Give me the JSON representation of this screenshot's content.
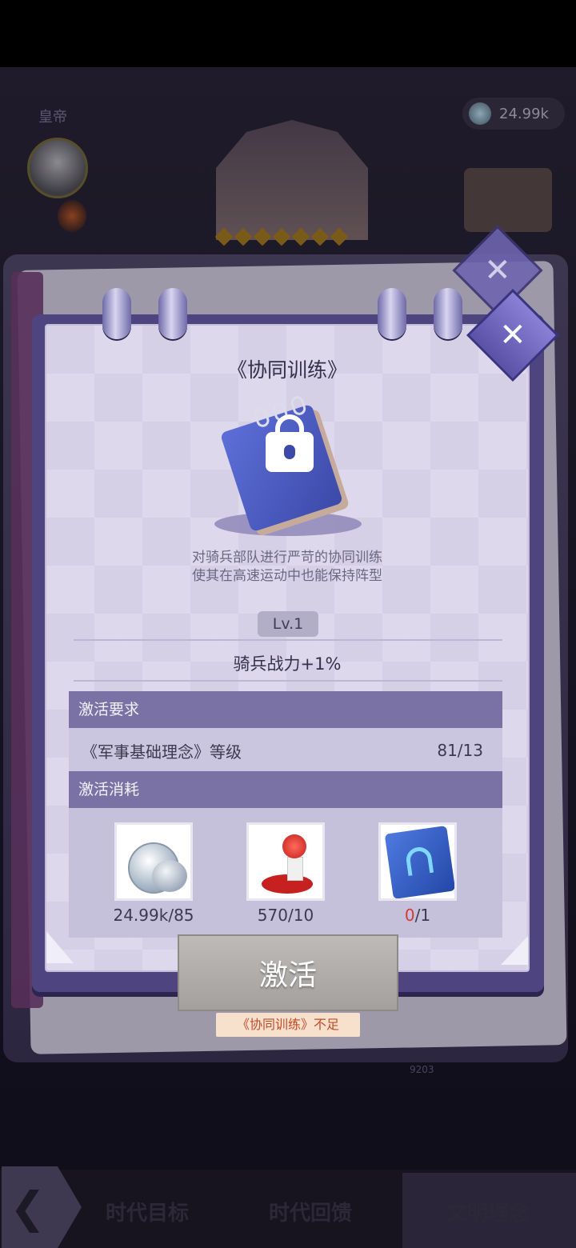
{
  "background": {
    "label_top_left": "皇帝",
    "currency_value": "24.99k",
    "small_number": "9203"
  },
  "dialog": {
    "title": "《协同训练》",
    "description_line1": "对骑兵部队进行严苛的协同训练",
    "description_line2": "使其在高速运动中也能保持阵型",
    "level": "Lv.1",
    "effect": "骑兵战力+1%",
    "requirement_header": "激活要求",
    "requirement_name": "《军事基础理念》等级",
    "requirement_value": "81/13",
    "cost_header": "激活消耗",
    "costs": [
      {
        "icon": "silver-coin-icon",
        "have": "24.99k",
        "need": "85"
      },
      {
        "icon": "red-stamp-icon",
        "have": "570",
        "need": "10"
      },
      {
        "icon": "blue-horseshoe-book-icon",
        "have": "0",
        "need": "1",
        "have_color": "#d33b3b"
      }
    ],
    "cost_separator": "/",
    "activate_label": "激活",
    "warning": "《协同训练》不足"
  },
  "bottom_nav": {
    "tabs": [
      "时代目标",
      "时代回馈",
      "文明理念"
    ],
    "active_tab": "文明理念"
  },
  "colors": {
    "panel": "#4e4480",
    "page": "#d5d0e6",
    "section_header": "#7a72a4",
    "button": "#a3a09d",
    "warning_text": "#c44a2a"
  }
}
